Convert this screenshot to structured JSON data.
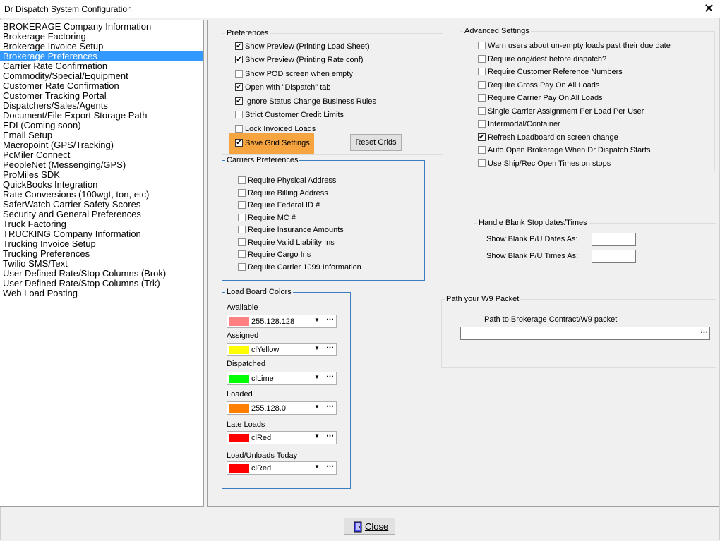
{
  "window": {
    "title": "Dr Dispatch  System Configuration",
    "close_glyph": "✕"
  },
  "nav": {
    "items": [
      "BROKERAGE Company Information",
      "Brokerage Factoring",
      "Brokerage Invoice Setup",
      "Brokerage Preferences",
      "Carrier Rate Confirmation",
      "Commodity/Special/Equipment",
      "Customer Rate Confirmation",
      "Customer Tracking Portal",
      "Dispatchers/Sales/Agents",
      "Document/File Export Storage Path",
      "EDI (Coming soon)",
      "Email Setup",
      "Macropoint (GPS/Tracking)",
      "PcMiler Connect",
      "PeopleNet (Messenging/GPS)",
      "ProMiles SDK",
      "QuickBooks Integration",
      "Rate Conversions (100wgt, ton, etc)",
      "SaferWatch Carrier Safety Scores",
      "Security and General Preferences",
      "Truck Factoring",
      "TRUCKING Company Information",
      "Trucking Invoice Setup",
      "Trucking Preferences",
      "Twilio SMS/Text",
      "User Defined Rate/Stop Columns (Brok)",
      "User Defined Rate/Stop Columns (Trk)",
      "Web Load Posting"
    ],
    "selected_index": 3
  },
  "preferences": {
    "caption": "Preferences",
    "options": [
      {
        "label": "Show Preview (Printing Load Sheet)",
        "checked": true
      },
      {
        "label": "Show Preview (Printing Rate conf)",
        "checked": true
      },
      {
        "label": "Show POD screen when empty",
        "checked": false
      },
      {
        "label": "Open with \"Dispatch\" tab",
        "checked": true
      },
      {
        "label": "Ignore Status Change Business Rules",
        "checked": true
      },
      {
        "label": "Strict Customer Credit Limits",
        "checked": false
      },
      {
        "label": "Lock Invoiced Loads",
        "checked": false
      },
      {
        "label": "Save Grid Settings",
        "checked": true
      }
    ],
    "reset_grids_label": "Reset Grids"
  },
  "carriers": {
    "caption": "Carriers Preferences",
    "options": [
      {
        "label": "Require Physical Address",
        "checked": false
      },
      {
        "label": "Require Billing Address",
        "checked": false
      },
      {
        "label": "Require Federal ID #",
        "checked": false
      },
      {
        "label": "Require MC #",
        "checked": false
      },
      {
        "label": "Require Insurance Amounts",
        "checked": false
      },
      {
        "label": "Require Valid Liability Ins",
        "checked": false
      },
      {
        "label": "Require Cargo Ins",
        "checked": false
      },
      {
        "label": "Require Carrier 1099 Information",
        "checked": false
      }
    ]
  },
  "loadboard": {
    "caption": "Load Board Colors",
    "rows": [
      {
        "label": "Available",
        "value": "255.128.128",
        "color": "#ff8080"
      },
      {
        "label": "Assigned",
        "value": "clYellow",
        "color": "#ffff00"
      },
      {
        "label": "Dispatched",
        "value": "clLime",
        "color": "#00ff00"
      },
      {
        "label": "Loaded",
        "value": "255.128.0",
        "color": "#ff8000"
      },
      {
        "label": "Late Loads",
        "value": "clRed",
        "color": "#ff0000"
      },
      {
        "label": "Load/Unloads Today",
        "value": "clRed",
        "color": "#ff0000"
      }
    ]
  },
  "advanced": {
    "caption": "Advanced Settings",
    "options": [
      {
        "label": "Warn users about un-empty loads past their due date",
        "checked": false
      },
      {
        "label": "Require orig/dest before dispatch?",
        "checked": false
      },
      {
        "label": "Require Customer Reference Numbers",
        "checked": false
      },
      {
        "label": "Require Gross Pay On All Loads",
        "checked": false
      },
      {
        "label": "Require Carrier Pay On All Loads",
        "checked": false
      },
      {
        "label": "Single Carrier Assignment Per Load Per User",
        "checked": false
      },
      {
        "label": "Intermodal/Container",
        "checked": false
      },
      {
        "label": "Refresh Loadboard on screen change",
        "checked": true
      },
      {
        "label": "Auto Open Brokerage When Dr Dispatch Starts",
        "checked": false
      },
      {
        "label": "Use Ship/Rec Open Times on stops",
        "checked": false
      }
    ]
  },
  "blank_stop": {
    "caption": "Handle Blank Stop dates/Times",
    "pu_dates_label": "Show Blank P/U Dates As:",
    "pu_times_label": "Show Blank P/U Times As:",
    "pu_dates_value": "",
    "pu_times_value": ""
  },
  "w9": {
    "caption": "Path your W9 Packet",
    "path_label": "Path to Brokerage Contract/W9 packet",
    "path_value": ""
  },
  "ellipsis": "⋯",
  "dropdown_glyph": "▼",
  "checkmark": "✔",
  "close_button": {
    "label": "Close",
    "icon": "door-icon"
  },
  "colors": {
    "selection": "#3399ff",
    "highlight": "#f5a440",
    "group_border": "#3a7fc4"
  }
}
